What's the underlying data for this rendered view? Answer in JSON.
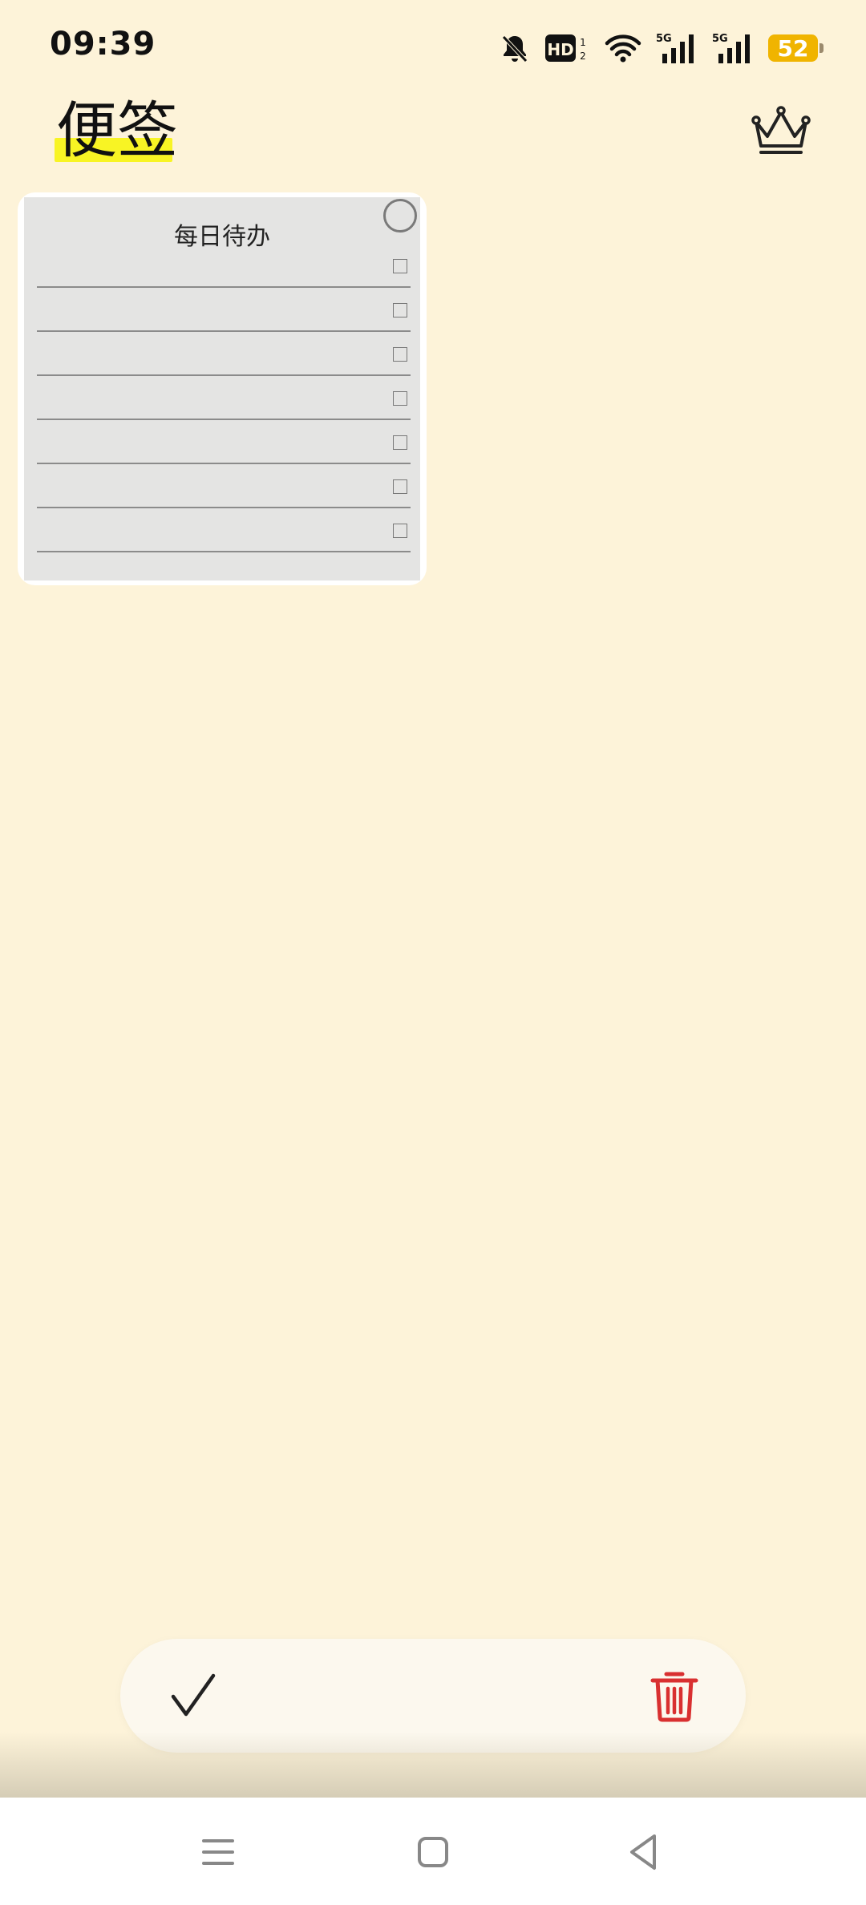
{
  "status_bar": {
    "time": "09:39",
    "battery_level": "52",
    "icons": [
      "bell-muted-icon",
      "hd-icon",
      "wifi-icon",
      "signal-5g-icon",
      "signal-5g-icon",
      "battery-icon"
    ],
    "hd_label": "HD",
    "network_label": "5G"
  },
  "header": {
    "title": "便签",
    "premium_icon": "crown-icon"
  },
  "note": {
    "title": "每日待办",
    "todo_items": [
      "",
      "",
      "",
      "",
      "",
      "",
      ""
    ]
  },
  "action_bar": {
    "confirm_icon": "check-icon",
    "delete_icon": "trash-icon",
    "delete_color": "#d93030"
  },
  "nav_bar": {
    "icons": [
      "menu-icon",
      "home-icon",
      "back-icon"
    ]
  }
}
